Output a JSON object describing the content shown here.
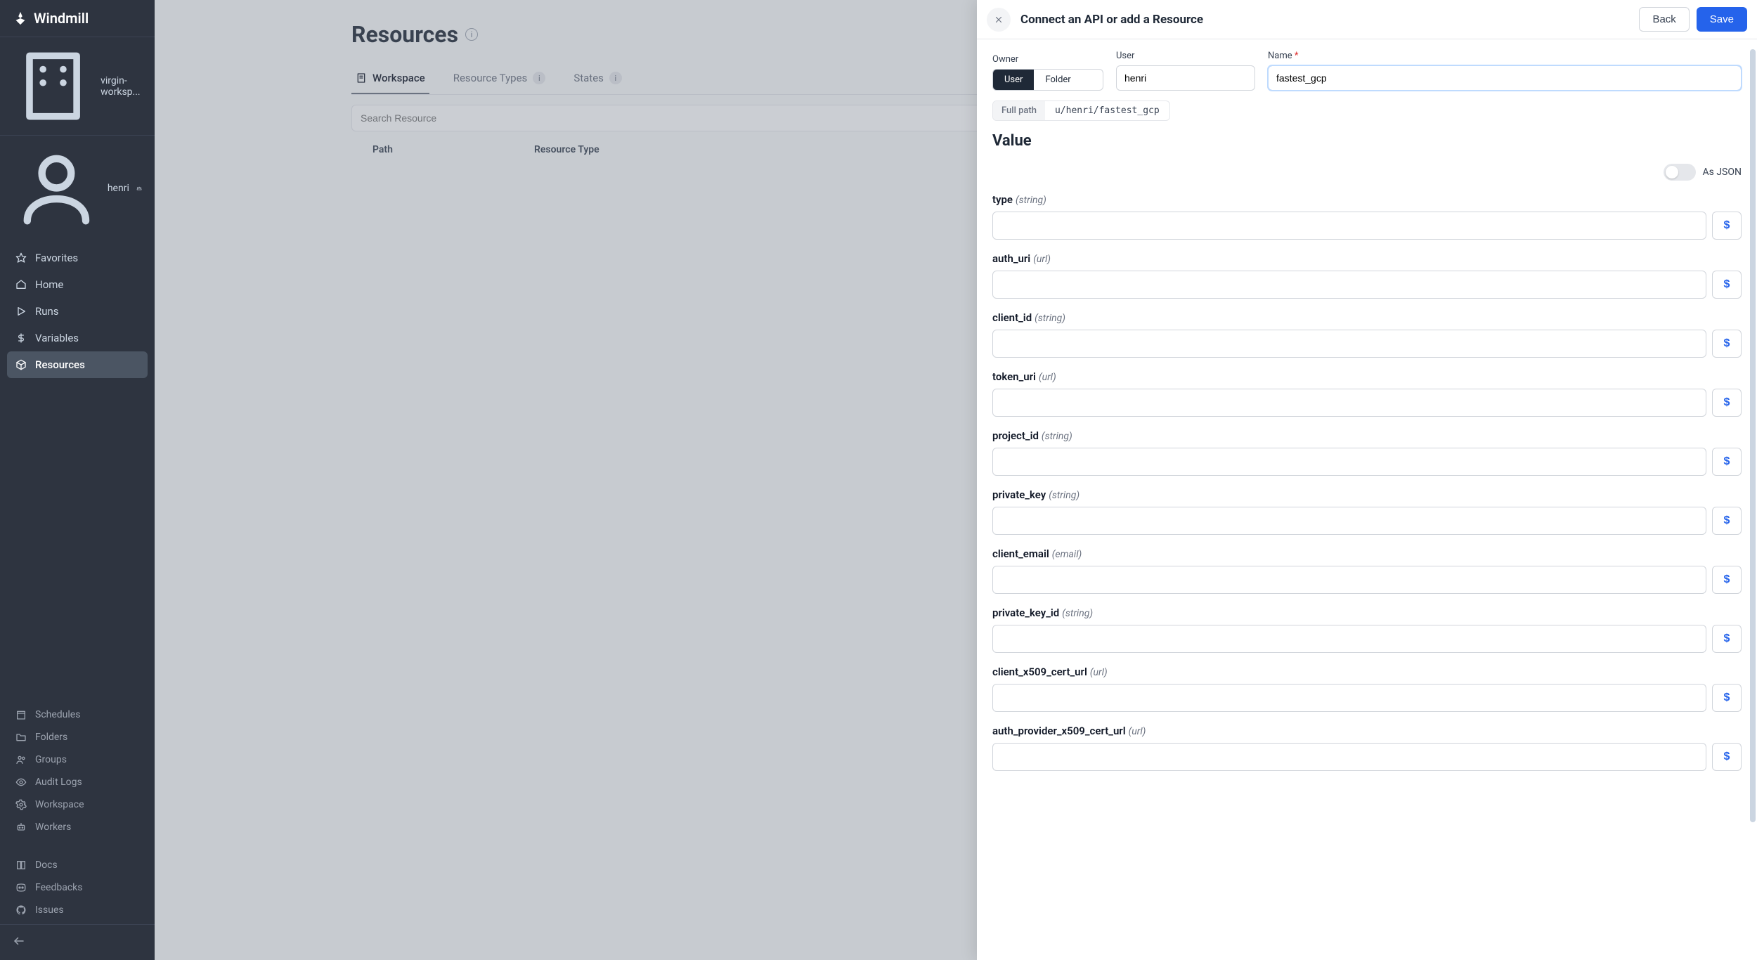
{
  "brand": "Windmill",
  "workspace_name": "virgin-worksp...",
  "current_user": "henri",
  "nav": {
    "favorites": "Favorites",
    "home": "Home",
    "runs": "Runs",
    "variables": "Variables",
    "resources": "Resources"
  },
  "secondary": {
    "schedules": "Schedules",
    "folders": "Folders",
    "groups": "Groups",
    "audit": "Audit Logs",
    "workspace": "Workspace",
    "workers": "Workers"
  },
  "footer": {
    "docs": "Docs",
    "feedbacks": "Feedbacks",
    "issues": "Issues"
  },
  "page": {
    "title": "Resources",
    "tabs": {
      "workspace": "Workspace",
      "resource_types": "Resource Types",
      "rt_badge": "i",
      "states": "States",
      "states_badge": "i"
    },
    "search_placeholder": "Search Resource",
    "th_path": "Path",
    "th_type": "Resource Type"
  },
  "drawer": {
    "title": "Connect an API or add a Resource",
    "back": "Back",
    "save": "Save",
    "owner_label": "Owner",
    "user_label": "User",
    "name_label": "Name",
    "seg_user": "User",
    "seg_folder": "Folder",
    "user_value": "henri",
    "name_value": "fastest_gcp",
    "full_path_label": "Full path",
    "full_path_value": "u/henri/fastest_gcp",
    "value_heading": "Value",
    "as_json": "As JSON",
    "dollar": "$",
    "fields": [
      {
        "name": "type",
        "type": "(string)"
      },
      {
        "name": "auth_uri",
        "type": "(url)"
      },
      {
        "name": "client_id",
        "type": "(string)"
      },
      {
        "name": "token_uri",
        "type": "(url)"
      },
      {
        "name": "project_id",
        "type": "(string)"
      },
      {
        "name": "private_key",
        "type": "(string)"
      },
      {
        "name": "client_email",
        "type": "(email)"
      },
      {
        "name": "private_key_id",
        "type": "(string)"
      },
      {
        "name": "client_x509_cert_url",
        "type": "(url)"
      },
      {
        "name": "auth_provider_x509_cert_url",
        "type": "(url)"
      }
    ]
  }
}
